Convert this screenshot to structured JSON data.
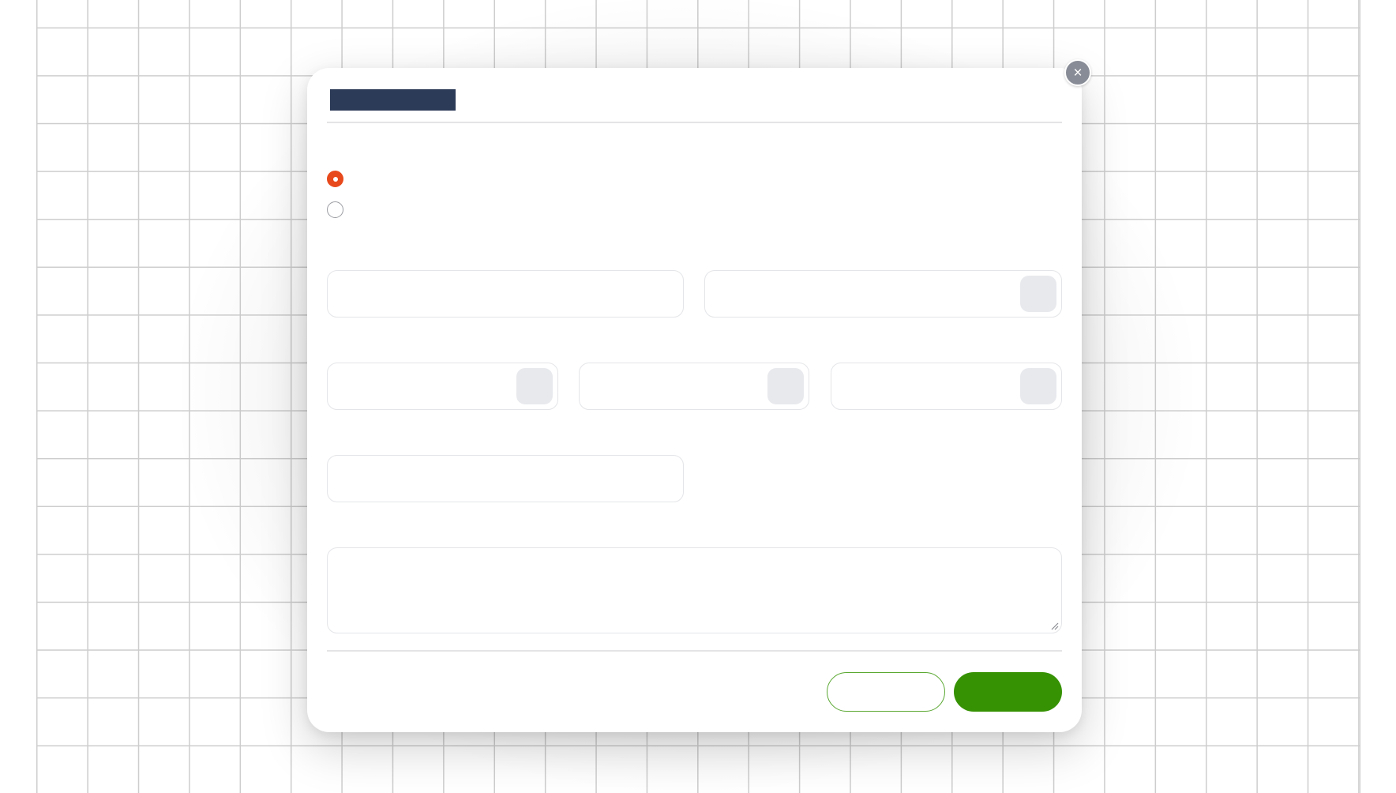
{
  "dialog": {
    "title": "",
    "close_label": "×",
    "intro_label": ""
  },
  "options": [
    {
      "label": "",
      "selected": true
    },
    {
      "label": "",
      "selected": false
    }
  ],
  "fields": {
    "row1_left": {
      "label": "",
      "value": ""
    },
    "row1_right": {
      "label": "",
      "value": "",
      "button_icon": "picker-icon"
    },
    "row2_a": {
      "label": "",
      "value": "",
      "button_icon": "picker-icon"
    },
    "row2_b": {
      "label": "",
      "value": "",
      "button_icon": "picker-icon"
    },
    "row2_c": {
      "label": "",
      "value": "",
      "button_icon": "picker-icon"
    },
    "row3_left": {
      "label": "",
      "value": ""
    },
    "notes": {
      "label": "",
      "value": ""
    }
  },
  "footer": {
    "note": "",
    "cancel_label": "",
    "submit_label": ""
  },
  "colors": {
    "title_block": "#2c3b57",
    "radio_selected": "#e8491c",
    "primary_button": "#369203",
    "secondary_button_border": "#5aa832",
    "close_button": "#888c96"
  }
}
